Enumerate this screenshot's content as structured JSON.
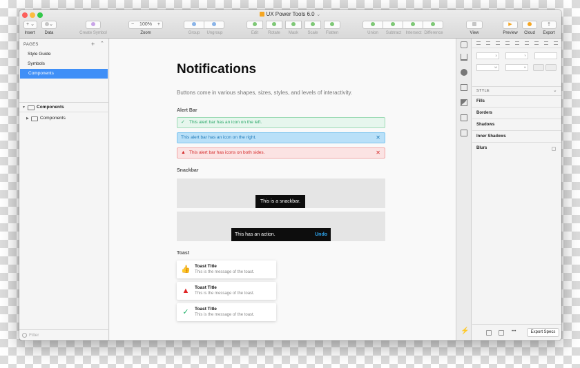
{
  "window": {
    "title": "UX Power Tools 6.0",
    "title_chevron": "⌄"
  },
  "toolbar": {
    "insert_label": "Insert",
    "data_label": "Data",
    "create_symbol_label": "Create Symbol",
    "zoom_label": "Zoom",
    "zoom_value": "100%",
    "zoom_minus": "−",
    "zoom_plus": "+",
    "group_label": "Group",
    "ungroup_label": "Ungroup",
    "edit_label": "Edit",
    "rotate_label": "Rotate",
    "mask_label": "Mask",
    "scale_label": "Scale",
    "flatten_label": "Flatten",
    "union_label": "Union",
    "subtract_label": "Subtract",
    "intersect_label": "Intersect",
    "difference_label": "Difference",
    "view_label": "View",
    "preview_label": "Preview",
    "cloud_label": "Cloud",
    "export_label": "Export",
    "insert_glyph": "+ ⌄",
    "data_glyph": "⌄"
  },
  "sidebar": {
    "pages_header": "PAGES",
    "add_glyph": "+",
    "collapse_glyph": "⌃",
    "pages": [
      {
        "label": "Style Guide",
        "active": false
      },
      {
        "label": "Symbols",
        "active": false
      },
      {
        "label": "Components",
        "active": true
      }
    ],
    "layers": [
      {
        "label": "Components",
        "level": 0,
        "expanded": true
      },
      {
        "label": "Components",
        "level": 1,
        "expanded": false
      }
    ],
    "filter_placeholder": "Filter"
  },
  "canvas": {
    "title": "Notifications",
    "intro": "Buttons come in various shapes, sizes, styles, and levels of interactivity.",
    "alert_section": "Alert Bar",
    "alerts": [
      {
        "text": "This alert bar has an icon on the left.",
        "icon": "check-icon",
        "icon_glyph": "✓",
        "close": "",
        "bg": "#e6f6ed",
        "border": "#9edbb6",
        "color": "#2aa769"
      },
      {
        "text": "This alert bar has an icon on the right.",
        "icon": "",
        "icon_glyph": "",
        "close": "✕",
        "bg": "#b9e0f8",
        "border": "#7dc5ef",
        "color": "#1f7ab8"
      },
      {
        "text": "This alert bar has icons on both sides.",
        "icon": "warning-icon",
        "icon_glyph": "▲",
        "close": "✕",
        "bg": "#fbe3e3",
        "border": "#f2a7a7",
        "color": "#d42a2a"
      }
    ],
    "snackbar_section": "Snackbar",
    "snackbars": [
      {
        "text": "This is a snackbar.",
        "action": ""
      },
      {
        "text": "This has an action.",
        "action": "Undo"
      }
    ],
    "toast_section": "Toast",
    "toasts": [
      {
        "title": "Toast Title",
        "message": "This is the message of the toast.",
        "icon": "thumbs-up-icon",
        "glyph": "👍",
        "color": "#2e8fe8"
      },
      {
        "title": "Toast Title",
        "message": "This is the message of the toast.",
        "icon": "warning-icon",
        "glyph": "▲",
        "color": "#e02424"
      },
      {
        "title": "Toast Title",
        "message": "This is the message of the toast.",
        "icon": "check-icon",
        "glyph": "✓",
        "color": "#21b26a"
      }
    ]
  },
  "inspector": {
    "x_label": "X",
    "y_label": "Y",
    "w_label": "W",
    "h_label": "H",
    "style_header": "STYLE",
    "chevron": "⌄",
    "properties": [
      "Fills",
      "Borders",
      "Shadows",
      "Inner Shadows",
      "Blurs"
    ],
    "more_glyph": "•••",
    "export_specs": "Export Specs"
  }
}
